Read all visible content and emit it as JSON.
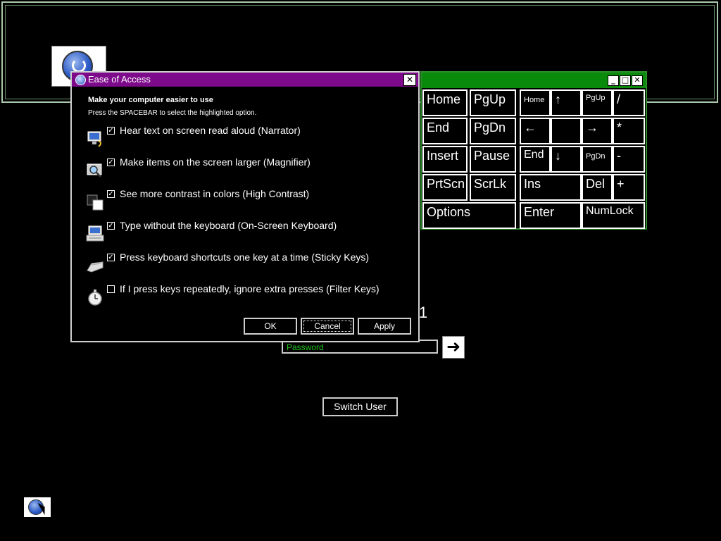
{
  "ease_dialog": {
    "title": "Ease of Access",
    "close": "✕",
    "heading": "Make your computer easier to use",
    "subheading": "Press the SPACEBAR to select the highlighted option.",
    "options": [
      {
        "label": "Hear text on screen read aloud (Narrator)",
        "checked": true,
        "check_mark": "✓",
        "icon": "narrator-icon"
      },
      {
        "label": "Make items on the screen larger (Magnifier)",
        "checked": true,
        "check_mark": "✓",
        "icon": "magnifier-icon"
      },
      {
        "label": "See more contrast in colors (High Contrast)",
        "checked": true,
        "check_mark": "✓",
        "icon": "high-contrast-icon"
      },
      {
        "label": "Type without the keyboard (On-Screen Keyboard)",
        "checked": true,
        "check_mark": "✓",
        "icon": "keyboard-icon"
      },
      {
        "label": "Press keyboard shortcuts one key at a time (Sticky Keys)",
        "checked": true,
        "check_mark": "✓",
        "icon": "sticky-keys-icon"
      },
      {
        "label": "If I press keys repeatedly, ignore extra presses (Filter Keys)",
        "checked": false,
        "check_mark": "",
        "icon": "filter-keys-icon"
      }
    ],
    "buttons": {
      "ok": "OK",
      "cancel": "Cancel",
      "apply": "Apply"
    }
  },
  "osk": {
    "controls": {
      "minimize": "_",
      "maximize": "□",
      "close": "✕"
    },
    "keys": {
      "home": "Home",
      "pgup": "PgUp",
      "np_home": "Home",
      "up": "↑",
      "np_pgup": "PgUp",
      "slash": "/",
      "end": "End",
      "pgdn": "PgDn",
      "left": "←",
      "blank": "",
      "right": "→",
      "star": "*",
      "insert": "Insert",
      "pause": "Pause",
      "np_end": "End",
      "down": "↓",
      "np_pgdn": "PgDn",
      "minus": "-",
      "prtscn": "PrtScn",
      "scrlk": "ScrLk",
      "ins": "Ins",
      "del": "Del",
      "plus": "+",
      "options": "Options",
      "enter": "Enter",
      "numlock": "NumLock"
    }
  },
  "login": {
    "password_placeholder": "Password",
    "submit_arrow": "➜",
    "partial_text": "1",
    "switch_user": "Switch User"
  }
}
